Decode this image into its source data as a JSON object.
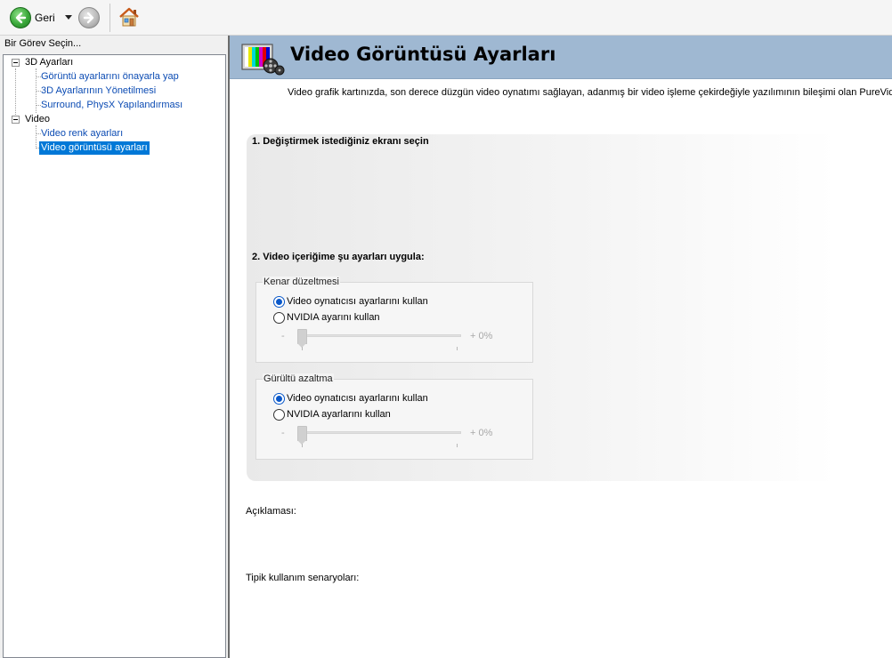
{
  "toolbar": {
    "back_label": "Geri",
    "back_icon": "back-arrow-icon",
    "forward_icon": "forward-arrow-icon",
    "home_icon": "home-icon"
  },
  "sidebar": {
    "header": "Bir Görev Seçin...",
    "categories": [
      {
        "label": "3D Ayarları",
        "items": [
          "Görüntü ayarlarını önayarla yap",
          "3D Ayarlarının Yönetilmesi",
          "Surround, PhysX Yapılandırması"
        ]
      },
      {
        "label": "Video",
        "items": [
          "Video renk ayarları",
          "Video görüntüsü ayarları"
        ]
      }
    ],
    "selected_item": "Video görüntüsü ayarları"
  },
  "main": {
    "title": "Video Görüntüsü Ayarları",
    "intro": "Video grafik kartınızda, son derece düzgün video oynatımı sağlayan, adanmış bir video işleme çekirdeğiyle yazılımının bileşimi olan PureVideo(TM)",
    "step1": "1. Değiştirmek istediğiniz ekranı seçin",
    "step2": "2. Video içeriğime şu ayarları uygula:",
    "edge": {
      "title": "Kenar düzeltmesi",
      "option1": "Video oynatıcısı ayarlarını kullan",
      "option2": "NVIDIA ayarını kullan",
      "selected": 1,
      "slider_min": "-",
      "slider_max": "+ 0%",
      "slider_value": 0
    },
    "noise": {
      "title": "Gürültü azaltma",
      "option1": "Video oynatıcısı ayarlarını kullan",
      "option2": "NVIDIA ayarlarını kullan",
      "selected": 1,
      "slider_min": "-",
      "slider_max": "+ 0%",
      "slider_value": 0
    },
    "description_label": "Açıklaması:",
    "scenarios_label": "Tipik kullanım senaryoları:"
  },
  "colors": {
    "banner": "#9fb8d2",
    "selection": "#0078d7",
    "link": "#0b4bb3"
  }
}
